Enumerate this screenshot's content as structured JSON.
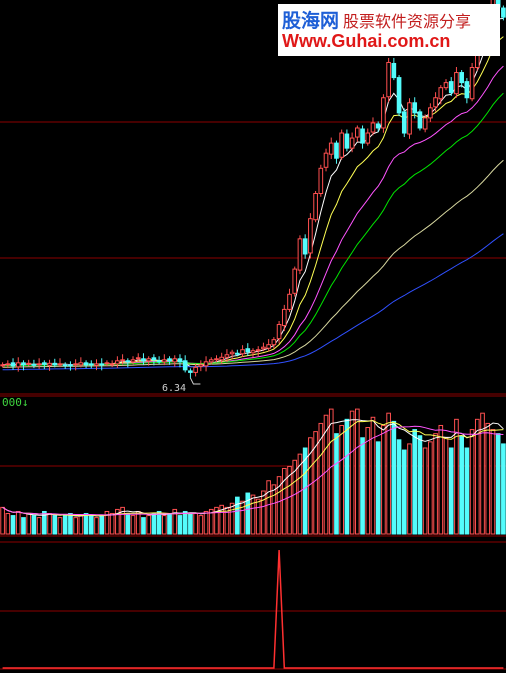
{
  "watermark": {
    "brand": "股海网",
    "tagline": "股票软件资源分享",
    "url": "Www.Guhai.com.cn"
  },
  "colors": {
    "background": "#000000",
    "up": "#ff5050",
    "down": "#54fcfc",
    "ma5": "#ffffff",
    "ma10": "#ffff54",
    "ma20": "#ff54ff",
    "ma30": "#00e600",
    "ma60": "#d8d8a0",
    "ma120": "#3050ff",
    "grid": "#8b0000",
    "signal": "#ff3030"
  },
  "chart_data": [
    {
      "type": "candlestick",
      "panel": "price",
      "low_marker": "6.34",
      "ohlc_start": [
        6.6,
        6.7,
        6.5,
        6.62
      ],
      "closes": [
        6.6,
        6.62,
        6.58,
        6.64,
        6.6,
        6.63,
        6.6,
        6.62,
        6.61,
        6.63,
        6.6,
        6.62,
        6.6,
        6.58,
        6.62,
        6.64,
        6.6,
        6.61,
        6.62,
        6.6,
        6.64,
        6.62,
        6.68,
        6.7,
        6.66,
        6.7,
        6.74,
        6.68,
        6.72,
        6.7,
        6.66,
        6.7,
        6.68,
        6.72,
        6.66,
        6.5,
        6.45,
        6.55,
        6.6,
        6.66,
        6.7,
        6.72,
        6.75,
        6.8,
        6.85,
        6.82,
        6.9,
        6.86,
        6.88,
        6.9,
        6.95,
        7.0,
        7.1,
        7.4,
        7.7,
        8.0,
        8.5,
        9.1,
        8.8,
        9.5,
        10.0,
        10.5,
        10.8,
        11.0,
        10.7,
        11.2,
        10.9,
        11.1,
        11.3,
        11.0,
        11.2,
        11.4,
        11.3,
        11.9,
        12.6,
        12.3,
        11.6,
        11.2,
        11.8,
        11.6,
        11.3,
        11.5,
        11.7,
        11.9,
        12.1,
        12.2,
        12.0,
        12.4,
        12.2,
        11.9,
        12.5,
        12.9,
        13.3,
        13.6,
        14.0,
        13.7,
        13.5
      ],
      "ma_periods": [
        5,
        10,
        20,
        30,
        60,
        120
      ],
      "ma_start": [
        6.6,
        6.6,
        6.6,
        6.58,
        6.55,
        6.5
      ],
      "ylim": [
        6.2,
        13.8
      ]
    },
    {
      "type": "bar",
      "panel": "volume",
      "label": "000",
      "values": [
        1.3,
        1.0,
        0.9,
        1.1,
        0.8,
        1.0,
        0.9,
        0.8,
        1.1,
        1.0,
        0.9,
        0.8,
        0.9,
        1.0,
        0.8,
        0.9,
        1.0,
        0.9,
        0.8,
        0.9,
        1.1,
        1.0,
        1.2,
        1.3,
        1.0,
        0.9,
        1.1,
        0.8,
        0.9,
        1.0,
        1.1,
        0.9,
        1.0,
        1.2,
        0.9,
        1.1,
        1.0,
        1.0,
        0.9,
        1.1,
        1.2,
        1.3,
        1.4,
        1.3,
        1.5,
        1.8,
        1.6,
        2.0,
        1.9,
        1.7,
        2.1,
        2.6,
        2.4,
        2.8,
        3.2,
        3.3,
        3.6,
        3.9,
        4.2,
        4.7,
        5.0,
        5.4,
        5.8,
        6.1,
        4.9,
        5.3,
        5.6,
        6.0,
        6.1,
        4.7,
        5.2,
        5.7,
        4.5,
        5.3,
        5.9,
        5.5,
        4.6,
        4.1,
        4.4,
        5.1,
        4.8,
        4.2,
        4.5,
        4.9,
        5.3,
        4.7,
        4.2,
        5.6,
        4.8,
        4.2,
        5.1,
        5.6,
        5.9,
        5.4,
        5.1,
        4.9,
        4.4
      ],
      "ma_periods": [
        5,
        10,
        20
      ],
      "ylim": [
        0,
        6.3
      ]
    },
    {
      "type": "line",
      "panel": "signal",
      "values": [
        0,
        0,
        0,
        0,
        0,
        0,
        0,
        0,
        0,
        0,
        0,
        0,
        0,
        0,
        0,
        0,
        0,
        0,
        0,
        0,
        0,
        0,
        0,
        0,
        0,
        0,
        0,
        0,
        0,
        0,
        0,
        0,
        0,
        0,
        0,
        0,
        0,
        0,
        0,
        0,
        0,
        0,
        0,
        0,
        0,
        0,
        0,
        0,
        0,
        0,
        0,
        0,
        0,
        1,
        0,
        0,
        0,
        0,
        0,
        0,
        0,
        0,
        0,
        0,
        0,
        0,
        0,
        0,
        0,
        0,
        0,
        0,
        0,
        0,
        0,
        0,
        0,
        0,
        0,
        0,
        0,
        0,
        0,
        0,
        0,
        0,
        0,
        0,
        0,
        0,
        0,
        0,
        0,
        0,
        0,
        0,
        0
      ],
      "ylim": [
        0,
        1
      ]
    }
  ]
}
